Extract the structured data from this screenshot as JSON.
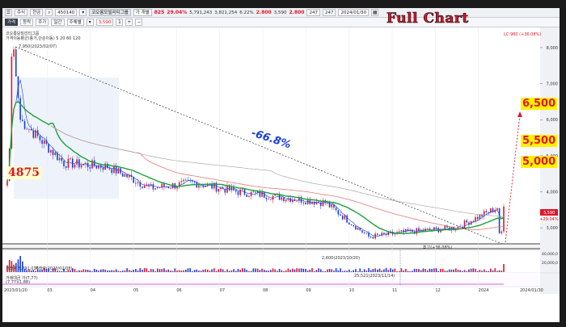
{
  "toolbar1": {
    "item_a": "주식",
    "item_b": "현금",
    "code": "450140",
    "name": "코오롱모빌리티그룹",
    "period_toggle": "가 개별",
    "price_info_a": "825",
    "price_info_b": "29.04%",
    "volume": "5,791,243",
    "value": "3,821,254",
    "num_a": "6.22%",
    "num_b": "2.800",
    "num_c": "3,590",
    "num_d": "2.800",
    "count_a": "247",
    "count_b": "247",
    "date": "2024/01/30"
  },
  "toolbar2": {
    "tabs": [
      "가격",
      "등락",
      "주가",
      "일간",
      "주체별"
    ],
    "current_price": "3,590",
    "zoom": "1"
  },
  "chart": {
    "title": "Full Chart",
    "indicator_title": "코오롱모빌리티그룹",
    "ma_label": "가격이동평균(종가,단순이동) 5 20 60 120",
    "lc_label": "LC:980 (+36.08%)",
    "high_label": "7,950(2023/02/07)",
    "low_label": "2,600(2023/10/20)",
    "mid_low_label": "최고(+36.08%)",
    "change_label": "-66.8%",
    "side_left_value": "4875",
    "targets": [
      "6,500",
      "5,500",
      "5,000"
    ],
    "current_price_tag": "3,590",
    "current_change_tag": "+29.04%",
    "volume_header": "거래량 5,791,036",
    "volume_max_label": "거래량(2023/02/08)",
    "volume_low_label": "25,521(2023/11/14)",
    "osc_label": "거래대금 가(7,77)",
    "osc_label2": "(7,77)(1,88)",
    "y_axis": [
      "8,000",
      "7,000",
      "6,000",
      "5,000",
      "4,000",
      "3,000"
    ],
    "vol_axis": [
      "40,000,0",
      "20,000,0"
    ],
    "x_axis": [
      "2023/01/20",
      "03",
      "04",
      "05",
      "06",
      "07",
      "08",
      "09",
      "10",
      "11",
      "12",
      "2024",
      "2024/01/30"
    ],
    "colors": {
      "up": "#e0162b",
      "down": "#1a3fd6",
      "ma5": "#1a3fd6",
      "ma20": "#1aa13a",
      "ma60": "#e07878",
      "ma120": "#aaaaaa",
      "annotation_bg": "#fff200"
    }
  },
  "chart_data": {
    "type": "candlestick",
    "title": "Full Chart",
    "x": [
      "2023/01",
      "2023/02",
      "2023/03",
      "2023/04",
      "2023/05",
      "2023/06",
      "2023/07",
      "2023/08",
      "2023/09",
      "2023/10",
      "2023/11",
      "2023/12",
      "2024/01"
    ],
    "close": [
      4600,
      6500,
      4800,
      4700,
      4100,
      4250,
      4000,
      3850,
      3700,
      2750,
      2900,
      3000,
      3590
    ],
    "high_point": {
      "date": "2023/02/07",
      "value": 7950
    },
    "low_point": {
      "date": "2023/10/20",
      "value": 2600
    },
    "change_pct": -66.8,
    "targets": [
      6500,
      5500,
      5000
    ],
    "ylim": [
      2600,
      8200
    ]
  }
}
